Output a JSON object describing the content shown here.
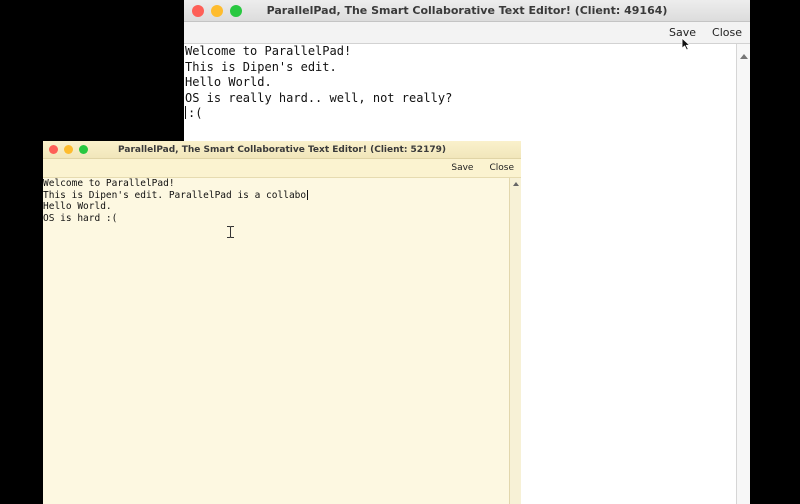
{
  "colors": {
    "close": "#fe5f57",
    "minimize": "#febc2e",
    "zoom": "#28c840"
  },
  "windows": {
    "back": {
      "title": "ParallelPad, The Smart Collaborative Text Editor! (Client: 49164)",
      "toolbar": {
        "save_label": "Save",
        "close_label": "Close"
      },
      "lines": [
        "Welcome to ParallelPad!",
        "This is Dipen's edit.",
        "Hello World.",
        "OS is really hard.. well, not really?",
        ":("
      ]
    },
    "front": {
      "title": "ParallelPad, The Smart Collaborative Text Editor! (Client: 52179)",
      "toolbar": {
        "save_label": "Save",
        "close_label": "Close"
      },
      "lines": [
        "Welcome to ParallelPad!",
        "This is Dipen's edit. ParallelPad is a collabo",
        "Hello World.",
        "OS is hard :("
      ]
    }
  },
  "icons": {
    "traffic_lights": [
      "close-button",
      "minimize-button",
      "zoom-button"
    ],
    "cursors": [
      "text-ibeam-icon",
      "mouse-pointer-icon"
    ]
  }
}
